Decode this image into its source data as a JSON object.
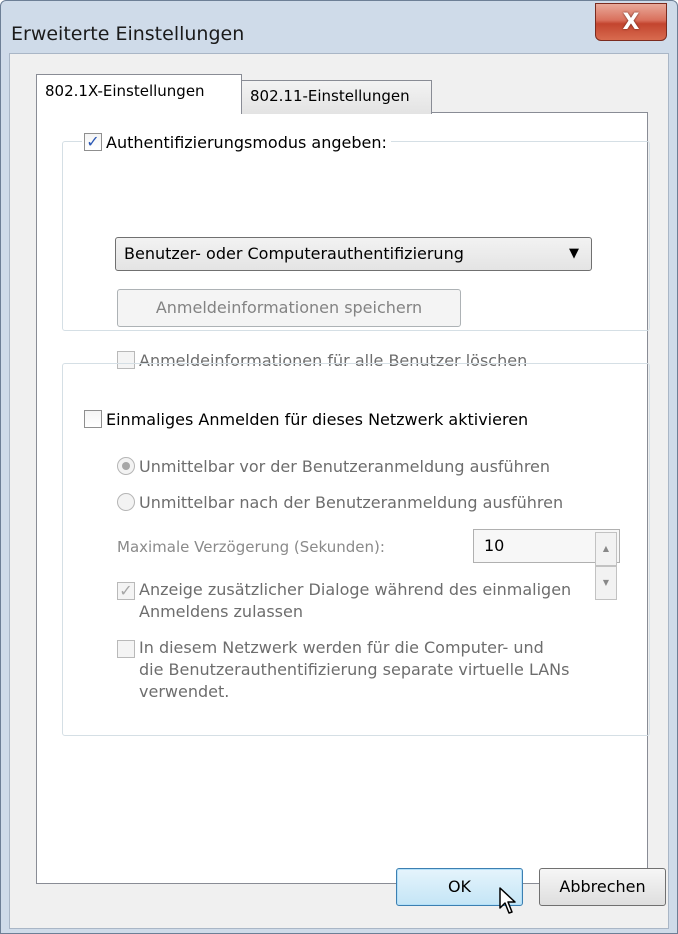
{
  "window": {
    "title": "Erweiterte Einstellungen",
    "close_label": "X"
  },
  "tabs": [
    {
      "label": "802.1X-Einstellungen",
      "active": true
    },
    {
      "label": "802.11-Einstellungen",
      "active": false
    }
  ],
  "auth_group": {
    "checkbox_label": "Authentifizierungsmodus angeben:",
    "checked": true,
    "mode_select_value": "Benutzer- oder Computerauthentifizierung",
    "save_credentials_label": "Anmeldeinformationen speichern",
    "delete_credentials_label": "Anmeldeinformationen für alle Benutzer löschen",
    "delete_credentials_checked": false
  },
  "sso_group": {
    "checkbox_label": "Einmaliges Anmelden für dieses Netzwerk aktivieren",
    "checked": false,
    "radio_before_label": "Unmittelbar vor der Benutzeranmeldung ausführen",
    "radio_before_selected": true,
    "radio_after_label": "Unmittelbar nach der Benutzeranmeldung ausführen",
    "radio_after_selected": false,
    "max_delay_label": "Maximale Verzögerung (Sekunden):",
    "max_delay_value": "10",
    "show_dialogs_label_line1": "Anzeige zusätzlicher Dialoge während des einmaligen",
    "show_dialogs_label_line2": "Anmeldens zulassen",
    "show_dialogs_checked": true,
    "separate_vlans_line1": "In diesem Netzwerk werden für die Computer- und",
    "separate_vlans_line2": "die Benutzerauthentifizierung separate virtuelle LANs",
    "separate_vlans_line3": "verwendet.",
    "separate_vlans_checked": false
  },
  "footer": {
    "ok_label": "OK",
    "cancel_label": "Abbrechen"
  },
  "icons": {
    "checkmark": "check-icon",
    "dropdown_arrow": "chevron-down-icon",
    "cursor": "mouse-pointer-icon"
  },
  "colors": {
    "title_bar": "#cfdbe9",
    "close_button": "#c3452f",
    "checkmark": "#2a57b4"
  }
}
